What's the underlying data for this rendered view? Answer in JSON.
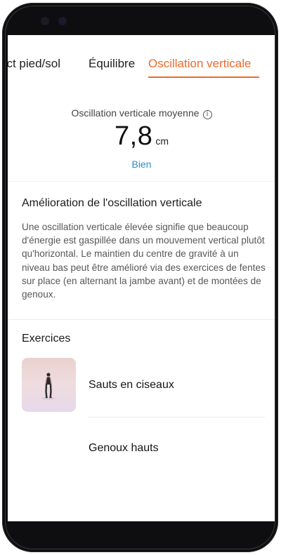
{
  "tabs": [
    {
      "label": "act pied/sol"
    },
    {
      "label": "Équilibre"
    },
    {
      "label": "Oscillation verticale"
    }
  ],
  "active_tab_index": 2,
  "metric": {
    "label": "Oscillation verticale moyenne",
    "info_icon": "i",
    "value": "7,8",
    "unit": "cm",
    "status": "Bien"
  },
  "improvement": {
    "title": "Amélioration de l'oscillation verticale",
    "body": "Une oscillation verticale élevée signifie que beaucoup d'énergie est gaspillée dans un mouvement vertical plutôt qu'horizontal. Le maintien du centre de gravité à un niveau bas peut être amélioré via des exercices de fentes sur place (en alternant la jambe avant) et de montées de genoux."
  },
  "exercises": {
    "title": "Exercices",
    "items": [
      {
        "label": "Sauts en ciseaux"
      },
      {
        "label": "Genoux hauts"
      }
    ]
  },
  "colors": {
    "accent": "#ea6a2c",
    "status": "#2a8ec4"
  }
}
